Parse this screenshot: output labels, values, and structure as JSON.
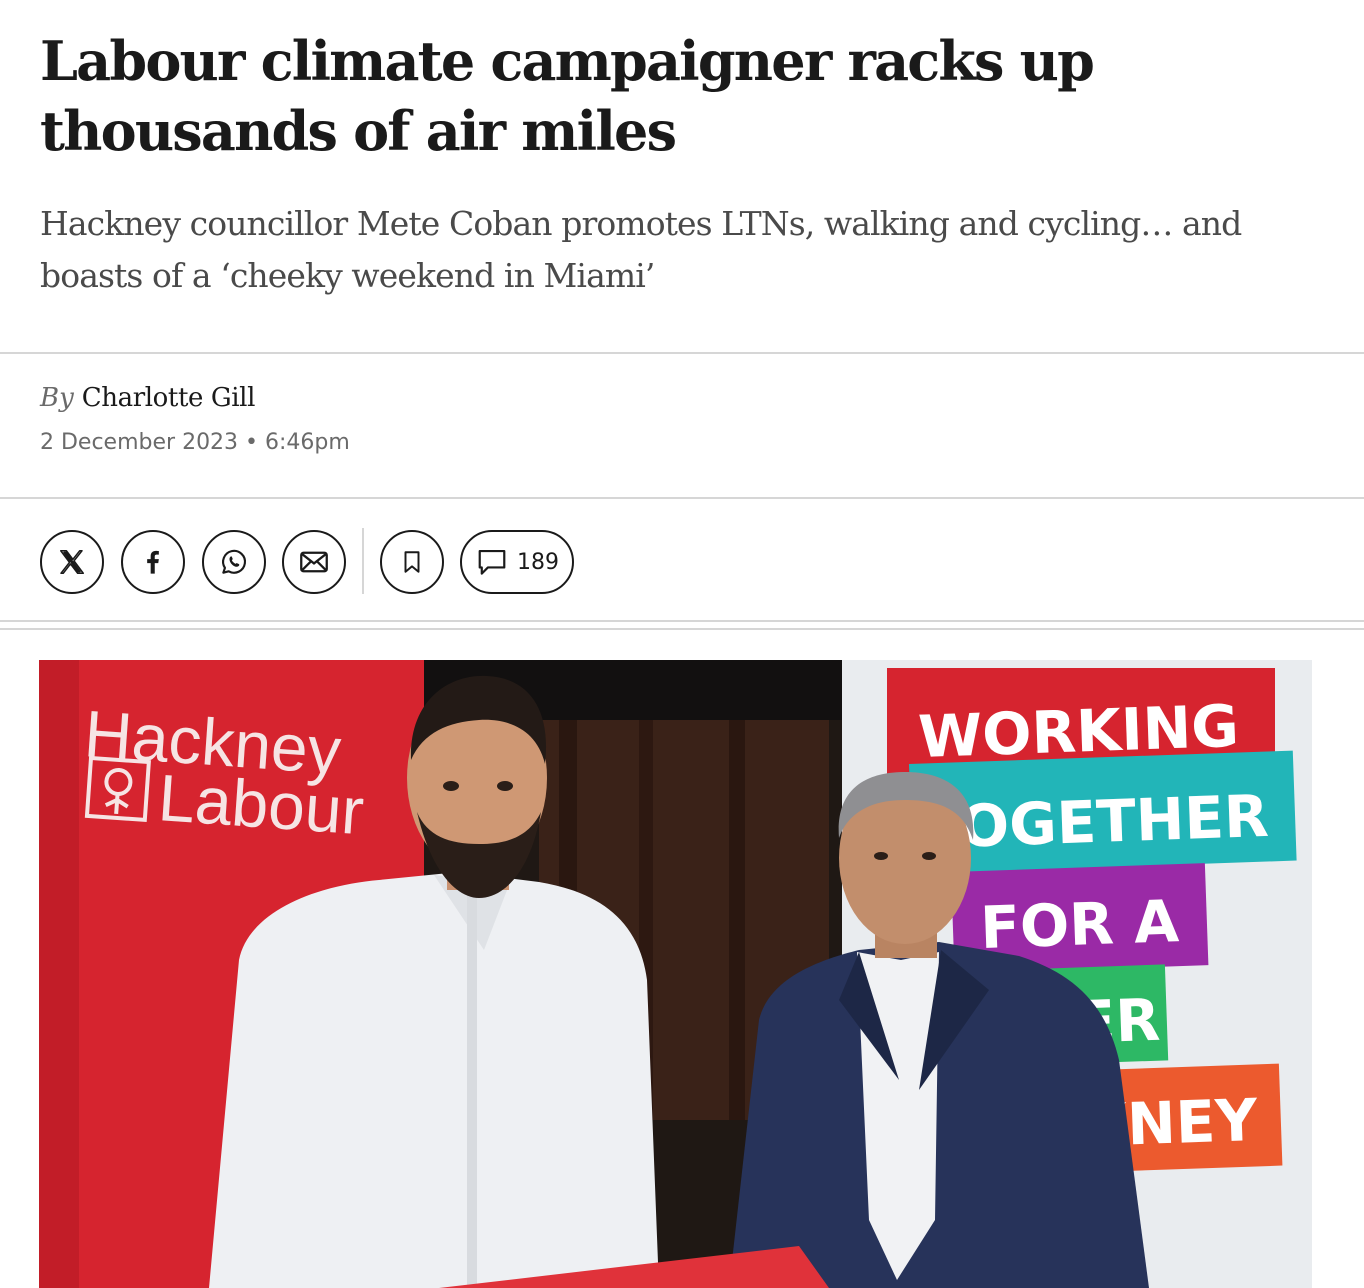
{
  "article": {
    "headline": "Labour climate campaigner racks up thousands of air miles",
    "standfirst": "Hackney councillor Mete Coban promotes LTNs, walking and cycling… and boasts of a ‘cheeky weekend in Miami’",
    "byline_prefix": "By",
    "author": "Charlotte Gill",
    "date": "2 December 2023 • 6:46pm"
  },
  "share": {
    "icons": [
      "x-icon",
      "facebook-icon",
      "whatsapp-icon",
      "email-icon",
      "bookmark-icon",
      "comment-icon"
    ],
    "comment_count": "189"
  },
  "hero_image": {
    "left_banner_text": [
      "Hackney",
      "Labour"
    ],
    "right_banner_lines": [
      "WORKING",
      "TOGETHER",
      "FOR A",
      "TER",
      "KNEY"
    ],
    "colors": {
      "labour_red": "#d6242f",
      "teal": "#22b5b8",
      "purple": "#9a2aa6",
      "green": "#2db865",
      "orange": "#ec5a2e"
    }
  }
}
